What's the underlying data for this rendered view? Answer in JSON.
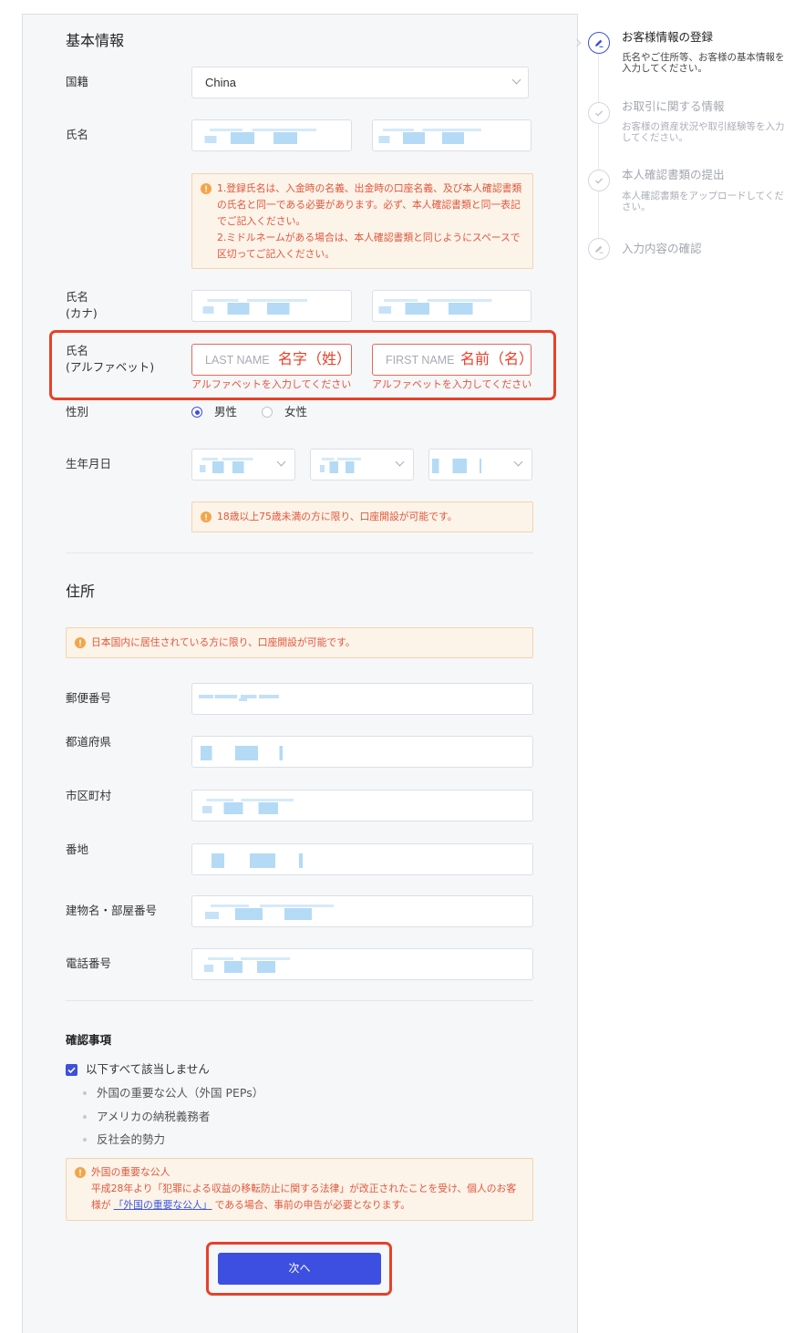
{
  "form": {
    "basic_info": {
      "title": "基本情報",
      "nationality": {
        "label": "国籍",
        "value": "China"
      },
      "name": {
        "label": "氏名"
      },
      "name_notice": {
        "lines": [
          "1.登録氏名は、入金時の名義、出金時の口座名義、及び本人確認書類",
          "の氏名と同一である必要があります。必ず、本人確認書類と同一表記",
          "でご記入ください。",
          "2.ミドルネームがある場合は、本人確認書類と同じようにスペースで",
          "区切ってご記入ください。"
        ]
      },
      "name_kana": {
        "label": "氏名",
        "label_sub": "(カナ)"
      },
      "name_alphabet": {
        "label": "氏名",
        "label_sub": "(アルファベット)",
        "last": {
          "placeholder": "LAST NAME",
          "annotation": "名字（姓）",
          "error": "アルファベットを入力してください"
        },
        "first": {
          "placeholder": "FIRST NAME",
          "annotation": "名前（名）",
          "error": "アルファベットを入力してください"
        }
      },
      "gender": {
        "label": "性別",
        "options": [
          {
            "label": "男性",
            "selected": true
          },
          {
            "label": "女性",
            "selected": false
          }
        ]
      },
      "birthdate": {
        "label": "生年月日"
      },
      "age_notice": "18歳以上75歳未満の方に限り、口座開設が可能です。"
    },
    "address": {
      "title": "住所",
      "residence_notice": "日本国内に居住されている方に限り、口座開設が可能です。",
      "fields": [
        {
          "label": "郵便番号"
        },
        {
          "label": "都道府県"
        },
        {
          "label": "市区町村"
        },
        {
          "label": "番地"
        },
        {
          "label": "建物名・部屋番号"
        },
        {
          "label": "電話番号"
        }
      ]
    },
    "confirmation": {
      "title": "確認事項",
      "checkbox": {
        "label": "以下すべて該当しません",
        "checked": true
      },
      "items": [
        "外国の重要な公人（外国 PEPs）",
        "アメリカの納税義務者",
        "反社会的勢力"
      ],
      "notice": {
        "title": "外国の重要な公人",
        "line1": "平成28年より「犯罪による収益の移転防止に関する法律」が改正されたことを受け、個人のお客",
        "line2_before": "様が",
        "line2_link": "「外国の重要な公人」",
        "line2_after": "である場合、事前の申告が必要となります。"
      }
    },
    "next_button": "次へ"
  },
  "stepper": {
    "steps": [
      {
        "title": "お客様情報の登録",
        "description": "氏名やご住所等、お客様の基本情報を入力してください。",
        "state": "active",
        "icon": "pencil-icon"
      },
      {
        "title": "お取引に関する情報",
        "description": "お客様の資産状況や取引経験等を入力してください。",
        "state": "pending",
        "icon": "check-icon"
      },
      {
        "title": "本人確認書類の提出",
        "description": "本人確認書類をアップロードしてください。",
        "state": "pending",
        "icon": "check-icon"
      },
      {
        "title": "入力内容の確認",
        "state": "pending",
        "icon": "pencil-icon"
      }
    ]
  },
  "colors": {
    "accent": "#3d4fe0",
    "notice_text": "#e2573b",
    "notice_bg": "#fcf3e9",
    "annotation_red": "#e8402a",
    "panel_bg": "#f6f7f9"
  }
}
